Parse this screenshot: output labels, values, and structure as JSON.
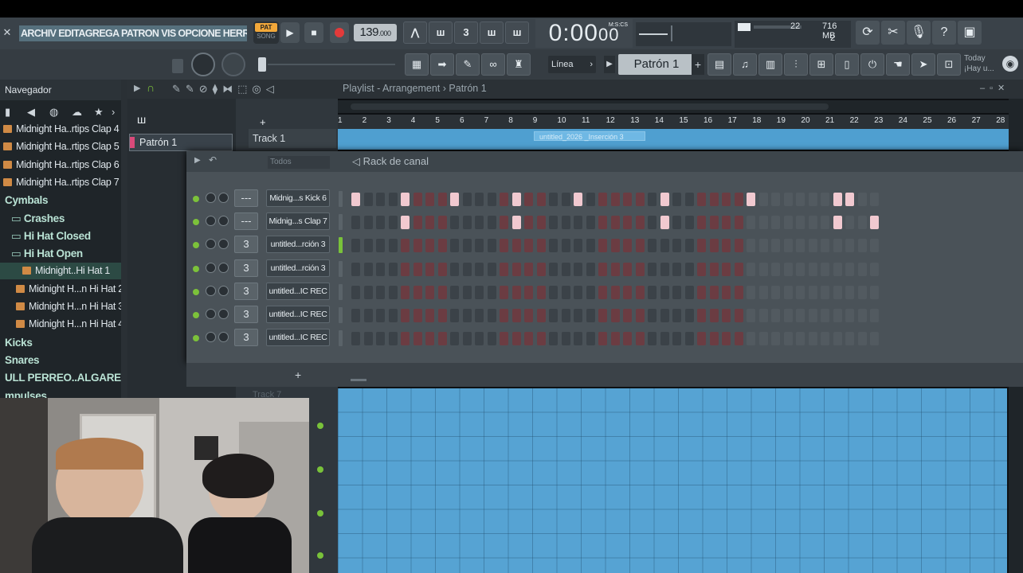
{
  "menu": {
    "text": "ARCHIV EDITAGREGA PATRON VIS OPCIONE HERRAMIENTA"
  },
  "transport": {
    "pat_label": "PAT",
    "song_label": "SONG",
    "tempo": "139",
    "tempo_frac": ".000",
    "time": "0:00",
    "time_sub": "00",
    "mscs": "M:S:CS"
  },
  "cpu": {
    "value": "22",
    "ram": "716 MB",
    "poly": "2"
  },
  "toolbar2": {
    "mode_label": "Línea",
    "pattern_label": "Patrón 1"
  },
  "hint": {
    "line1": "Today",
    "line2": "¡Hay u..."
  },
  "browser": {
    "title": "Navegador",
    "items": [
      {
        "label": "Midnight Ha..rtips Clap 4",
        "type": "sample",
        "indent": 0
      },
      {
        "label": "Midnight Ha..rtips Clap 5",
        "type": "sample",
        "indent": 0
      },
      {
        "label": "Midnight Ha..rtips Clap 6",
        "type": "sample",
        "indent": 0
      },
      {
        "label": "Midnight Ha..rtips Clap 7",
        "type": "sample",
        "indent": 0
      },
      {
        "label": "Cymbals",
        "type": "folder",
        "indent": 0
      },
      {
        "label": "Crashes",
        "type": "folder",
        "indent": 1
      },
      {
        "label": "Hi Hat Closed",
        "type": "folder",
        "indent": 1
      },
      {
        "label": "Hi Hat Open",
        "type": "folder",
        "indent": 1
      },
      {
        "label": "Midnight..Hi Hat 1",
        "type": "sample",
        "indent": 3,
        "selected": true
      },
      {
        "label": "Midnight H...n Hi Hat 2",
        "type": "sample",
        "indent": 2
      },
      {
        "label": "Midnight H...n Hi Hat 3",
        "type": "sample",
        "indent": 2
      },
      {
        "label": "Midnight H...n Hi Hat 4",
        "type": "sample",
        "indent": 2
      },
      {
        "label": "Kicks",
        "type": "folder",
        "indent": 0
      },
      {
        "label": "Snares",
        "type": "folder",
        "indent": 0
      },
      {
        "label": "ULL PERREO..ALGARE BEATZ",
        "type": "folder",
        "indent": 0
      },
      {
        "label": "mpulses",
        "type": "folder",
        "indent": 0
      }
    ]
  },
  "playlist": {
    "title": "Playlist - Arrangement",
    "sep": "›",
    "pattern": "Patrón 1",
    "pattern_item": "Patrón 1",
    "track1": "Track 1",
    "track7": "Track 7",
    "clip_label": "untitled_2026 _Inserción 3",
    "ruler": [
      "1",
      "2",
      "3",
      "4",
      "5",
      "6",
      "7",
      "8",
      "9",
      "10",
      "11",
      "12",
      "13",
      "14",
      "15",
      "16",
      "17",
      "18",
      "19",
      "20",
      "21",
      "22",
      "23",
      "24",
      "25",
      "26",
      "27",
      "28"
    ]
  },
  "rack": {
    "title": "Rack de canal",
    "filter": "Todos",
    "add": "+",
    "channels": [
      {
        "name": "Midnig...s Kick 6",
        "mixer": "---",
        "steps": [
          1,
          0,
          0,
          0,
          1,
          0,
          0,
          0,
          1,
          0,
          0,
          0,
          0,
          1,
          0,
          0,
          0,
          0,
          1,
          0,
          0,
          0,
          0,
          0,
          0,
          1,
          0,
          0,
          0,
          0,
          0,
          0,
          1,
          0,
          0,
          0,
          0,
          0,
          0,
          1,
          1,
          0,
          0
        ]
      },
      {
        "name": "Midnig...s Clap 7",
        "mixer": "---",
        "steps": [
          0,
          0,
          0,
          0,
          1,
          0,
          0,
          0,
          0,
          0,
          0,
          0,
          0,
          1,
          0,
          0,
          0,
          0,
          0,
          0,
          0,
          0,
          0,
          0,
          0,
          1,
          0,
          0,
          0,
          0,
          0,
          0,
          0,
          0,
          0,
          0,
          0,
          0,
          0,
          1,
          0,
          0,
          1
        ]
      },
      {
        "name": "untitled...rción 3",
        "mixer": "3",
        "steps": [],
        "selected": true
      },
      {
        "name": "untitled...rción 3",
        "mixer": "3",
        "steps": []
      },
      {
        "name": "untitled...IC REC",
        "mixer": "3",
        "steps": []
      },
      {
        "name": "untitled...IC REC",
        "mixer": "3",
        "steps": []
      },
      {
        "name": "untitled...IC REC",
        "mixer": "3",
        "steps": []
      }
    ]
  },
  "colors": {
    "accent": "#79c23a",
    "playlist_blue": "#56a3d3",
    "step_on": "#f1c9d0",
    "step_off": "#6b3c42"
  }
}
